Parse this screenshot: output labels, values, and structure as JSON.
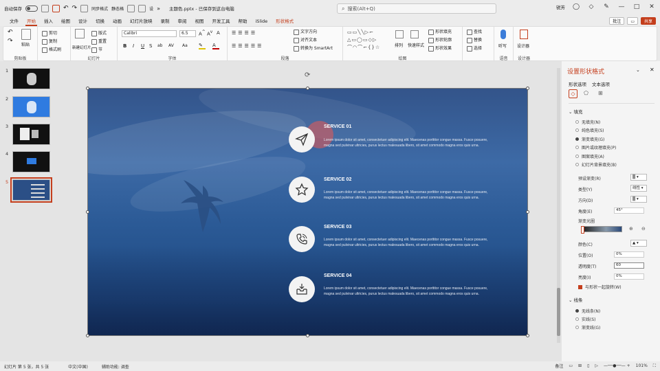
{
  "titlebar": {
    "autosave": "自动保存",
    "filename": "主题色.pptx - 已保存到这台电脑",
    "search_placeholder": "搜索(Alt+Q)",
    "quick": [
      "同步格式",
      "静态格",
      "设"
    ],
    "user": "锐芳"
  },
  "menu": {
    "tabs": [
      "文件",
      "开始",
      "插入",
      "绘图",
      "设计",
      "切换",
      "动画",
      "幻灯片放映",
      "录制",
      "审阅",
      "视图",
      "开发工具",
      "帮助",
      "iSlide",
      "形状格式"
    ],
    "active_index": 1,
    "comment": "批注",
    "share": "共享"
  },
  "ribbon": {
    "groups": [
      "剪贴板",
      "幻灯片",
      "字体",
      "段落",
      "绘图",
      "语音",
      "设计器"
    ],
    "paste": "粘贴",
    "cut": "剪切",
    "copy": "复制",
    "format_painter": "格式刷",
    "new_slide": "新建幻灯片",
    "layout": "版式",
    "reset": "重置",
    "section": "节",
    "font_name": "Calibri",
    "font_size": "6.5",
    "text_direction": "文字方向",
    "align_text": "对齐文本",
    "smartart": "转换为 SmartArt",
    "arrange": "排列",
    "quick_styles": "快速样式",
    "shape_fill": "形状填充",
    "shape_outline": "形状轮廓",
    "shape_effects": "形状效果",
    "find": "查找",
    "replace": "替换",
    "select": "选择",
    "dictate": "听写",
    "designer": "设计器"
  },
  "thumbnails": [
    {
      "num": "1",
      "bg": "#111111"
    },
    {
      "num": "2",
      "bg": "#2f7be0"
    },
    {
      "num": "3",
      "bg": "#111111"
    },
    {
      "num": "4",
      "bg": "#111111"
    },
    {
      "num": "5",
      "bg": "#2b4f86"
    }
  ],
  "slide": {
    "services": [
      {
        "title": "SERVICE 01",
        "icon": "paper-plane-icon",
        "body": "Lorem ipsum dolor sit amet, consectetuer adipiscing elit. Maecenas porttitor congue massa. Fusce posuere, magna sed pulvinar ultricies, purus lectus malesuada libero, sit amet commodo magna eros quis urna."
      },
      {
        "title": "SERVICE 02",
        "icon": "star-icon",
        "body": "Lorem ipsum dolor sit amet, consectetuer adipiscing elit. Maecenas porttitor congue massa. Fusce posuere, magna sed pulvinar ultricies, purus lectus malesuada libero, sit amet commodo magna eros quis urna."
      },
      {
        "title": "SERVICE 03",
        "icon": "phone-icon",
        "body": "Lorem ipsum dolor sit amet, consectetuer adipiscing elit. Maecenas porttitor congue massa. Fusce posuere, magna sed pulvinar ultricies, purus lectus malesuada libero, sit amet commodo magna eros quis urna."
      },
      {
        "title": "SERVICE 04",
        "icon": "inbox-icon",
        "body": "Lorem ipsum dolor sit amet, consectetuer adipiscing elit. Maecenas porttitor congue massa. Fusce posuere, magna sed pulvinar ultricies, purus lectus malesuada libero, sit amet commodo magna eros quis urna."
      }
    ]
  },
  "format_panel": {
    "title": "设置形状格式",
    "tabs": [
      "形状选项",
      "文本选项"
    ],
    "fill_section": "填充",
    "fill_options": [
      "无填充(N)",
      "纯色填充(S)",
      "渐变填充(G)",
      "图片或纹理填充(P)",
      "图案填充(A)",
      "幻灯片背景填充(B)"
    ],
    "fill_selected": 2,
    "preset_gradient": "预设渐变(R)",
    "type": "类型(Y)",
    "type_value": "线性",
    "direction": "方向(D)",
    "angle": "角度(E)",
    "angle_value": "45°",
    "gradient_stops": "渐变光圈",
    "color": "颜色(C)",
    "position": "位置(O)",
    "position_value": "0%",
    "transparency": "透明度(T)",
    "transparency_value": "60",
    "brightness": "亮度(I)",
    "brightness_value": "0%",
    "rotate_with_shape": "与形状一起旋转(W)",
    "line_section": "线条",
    "line_options": [
      "无线条(N)",
      "实线(S)",
      "渐变线(G)"
    ],
    "line_selected": 0
  },
  "status": {
    "slide": "幻灯片 第 5 张，共 5 张",
    "language": "中文(中国)",
    "accessibility": "辅助功能: 调查",
    "notes": "备注",
    "zoom": "101%"
  }
}
